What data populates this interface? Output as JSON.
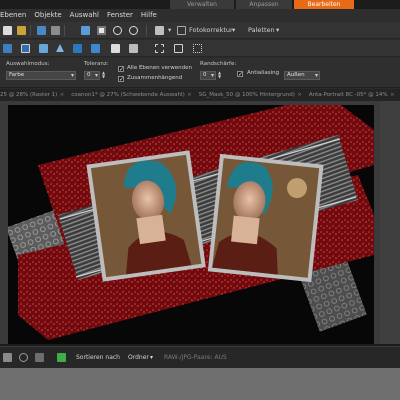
{
  "mode_tabs": [
    {
      "label": "Verwalten"
    },
    {
      "label": "Anpassen"
    },
    {
      "label": "Bearbeiten"
    }
  ],
  "colors": {
    "accent": "#e86a17",
    "canvas_bg": "#070707",
    "glitter_red": "#8a0f12",
    "frame_silver": "#b5b5b5"
  },
  "menu": {
    "items": [
      {
        "label": "Ebenen"
      },
      {
        "label": "Objekte"
      },
      {
        "label": "Auswahl"
      },
      {
        "label": "Fenster"
      },
      {
        "label": "Hilfe"
      }
    ]
  },
  "toolbar": {
    "fotokorrektur_label": "Fotokorrektur",
    "paletten_label": "Paletten",
    "icons_row1": [
      "new-icon",
      "open-icon",
      "save-icon",
      "print-icon",
      "image-icon",
      "resize-icon",
      "zoom-out-icon",
      "zoom-in-icon",
      "copy-icon"
    ],
    "icons_row2": [
      "layers-icon",
      "grid-icon",
      "photo-icon",
      "triangle-icon",
      "rect-icon",
      "square-icon",
      "fill-icon",
      "select-icon",
      "brush-icon",
      "adjust-icon"
    ]
  },
  "options": {
    "auswahlmodus_label": "Auswahlmodus:",
    "auswahlmodus_value": "Farbe",
    "toleranz_label": "Toleranz:",
    "toleranz_value": "0",
    "alle_ebenen_label": "Alle Ebenen verwenden",
    "alle_ebenen_checked": true,
    "zusammenhaengend_label": "Zusammenhängend",
    "zusammenhaengend_checked": true,
    "randschaerfe_label": "Randschärfe:",
    "randschaerfe_value": "0",
    "antialiasing_label": "Antialiasing",
    "antialiasing_checked": true,
    "antialiasing_value": "Außen"
  },
  "doc_tabs": [
    {
      "label": "25 @ 28% (Raster 1)"
    },
    {
      "label": "coanon1* @ 27% (Schwebende Auswahl)"
    },
    {
      "label": "SG_Mask_50 @ 100% Hintergrund)"
    },
    {
      "label": "Anta-Portrait 8C -05* @ 14%"
    }
  ],
  "bottom": {
    "sortieren_label": "Sortieren nach",
    "ordner_label": "Ordner",
    "raw_label": "RAW-/JPG-Paare: AUS"
  }
}
